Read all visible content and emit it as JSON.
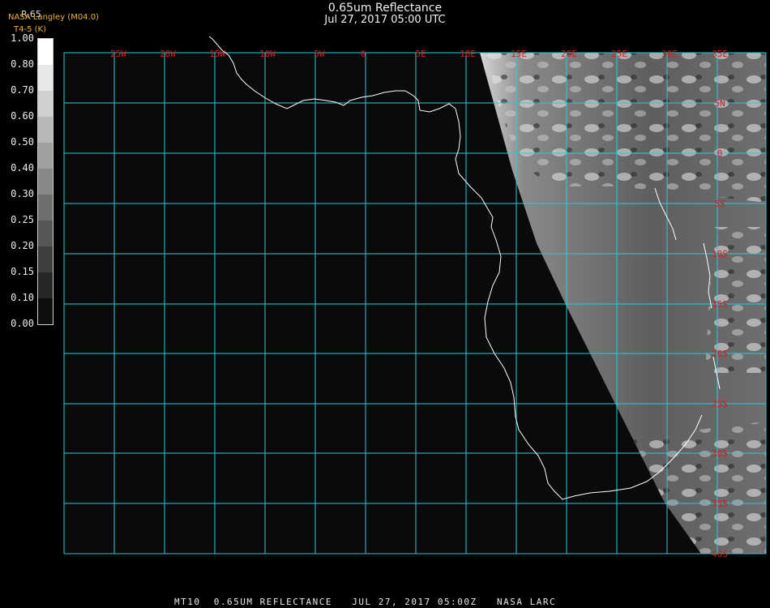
{
  "header": {
    "title": "0.65um Reflectance",
    "subtitle": "Jul 27, 2017 05:00 UTC",
    "credit": "NASA Langley (M04.0)",
    "units": "T4-5 (K)",
    "product": "R.65"
  },
  "colorbar": {
    "labels": [
      "1.00",
      "0.80",
      "0.70",
      "0.60",
      "0.50",
      "0.40",
      "0.30",
      "0.25",
      "0.20",
      "0.15",
      "0.10",
      "0.00"
    ]
  },
  "map": {
    "longitude_labels": [
      "25W",
      "20W",
      "15W",
      "10W",
      "5W",
      "0",
      "5E",
      "10E",
      "15E",
      "20E",
      "25E",
      "30E",
      "35E"
    ],
    "latitude_labels": [
      "5N",
      "0",
      "5S",
      "10S",
      "15S",
      "20S",
      "25S",
      "30S",
      "35S",
      "40S"
    ],
    "colors": {
      "grid": "#2ec8d8",
      "label": "#d02020",
      "coast": "#ffffff",
      "background": "#0a0a0a"
    },
    "icons": [
      "coastline",
      "cloud-field"
    ]
  },
  "footer": {
    "text": "MT10  0.65UM REFLECTANCE   JUL 27, 2017 05:00Z   NASA LARC"
  }
}
